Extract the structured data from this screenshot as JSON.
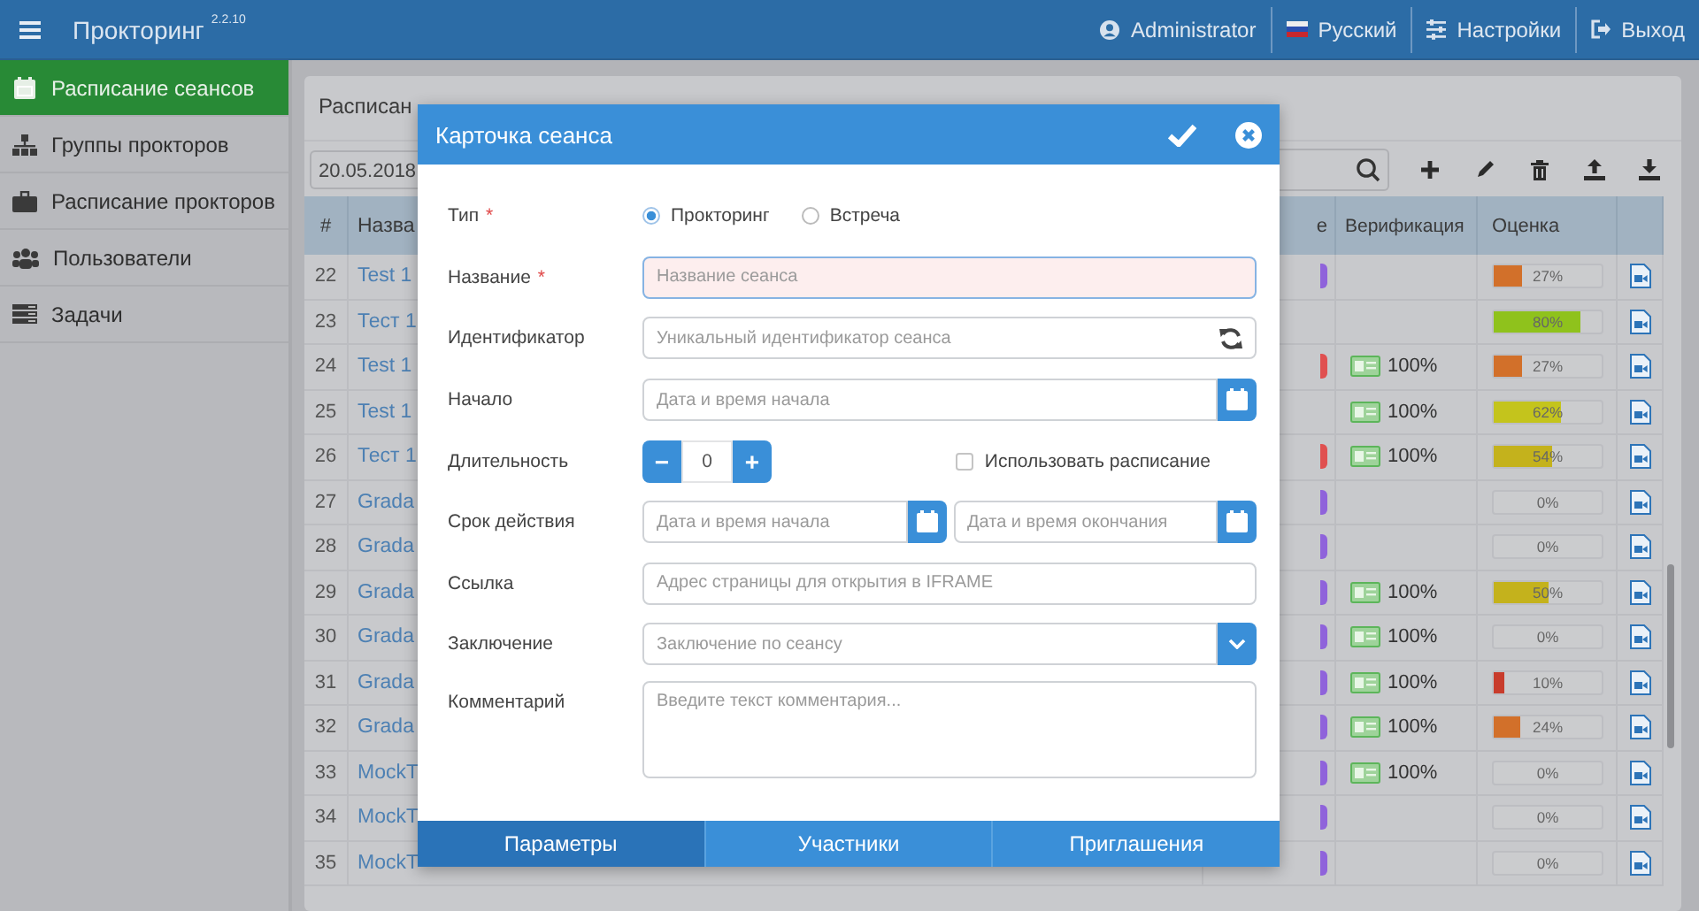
{
  "topbar": {
    "title": "Прокторинг",
    "version": "2.2.10",
    "menu": [
      {
        "kind": "user",
        "label": "Administrator"
      },
      {
        "kind": "language",
        "label": "Русский"
      },
      {
        "kind": "settings",
        "label": "Настройки"
      },
      {
        "kind": "logout",
        "label": "Выход"
      }
    ]
  },
  "sidebar": {
    "items": [
      {
        "kind": "calendar",
        "label": "Расписание сеансов",
        "selected": true
      },
      {
        "kind": "groups",
        "label": "Группы прокторов",
        "selected": false
      },
      {
        "kind": "briefcase",
        "label": "Расписание прокторов",
        "selected": false
      },
      {
        "kind": "users",
        "label": "Пользователи",
        "selected": false
      },
      {
        "kind": "tasks",
        "label": "Задачи",
        "selected": false
      }
    ]
  },
  "panel": {
    "title": "Расписан",
    "date_filter": "20.05.2018",
    "table": {
      "columns": [
        "#",
        "Назва",
        "е",
        "Верификация",
        "Оценка"
      ],
      "rows": [
        {
          "num": "22",
          "name": "Test 1",
          "color": "#8f63db",
          "score": {
            "level": 0.27,
            "text": "27%",
            "color": "#d2702a"
          }
        },
        {
          "num": "23",
          "name": "Тест 1",
          "score": {
            "level": 0.8,
            "text": "80%",
            "color": "#8fc21c"
          }
        },
        {
          "num": "24",
          "name": "Test 1",
          "color": "#e05050",
          "verification": "100%",
          "score": {
            "level": 0.27,
            "text": "27%",
            "color": "#d2702a"
          }
        },
        {
          "num": "25",
          "name": "Test 1",
          "verification": "100%",
          "score": {
            "level": 0.62,
            "text": "62%",
            "color": "#c4c41c"
          }
        },
        {
          "num": "26",
          "name": "Тест 1",
          "color": "#e05050",
          "verification": "100%",
          "score": {
            "level": 0.54,
            "text": "54%",
            "color": "#c4b21c"
          }
        },
        {
          "num": "27",
          "name": "Grada",
          "color": "#8f63db",
          "score": {
            "text": "0%"
          }
        },
        {
          "num": "28",
          "name": "Grada",
          "color": "#8f63db",
          "score": {
            "text": "0%"
          }
        },
        {
          "num": "29",
          "name": "Grada",
          "color": "#8f63db",
          "verification": "100%",
          "score": {
            "level": 0.5,
            "text": "50%",
            "color": "#c4b21c"
          }
        },
        {
          "num": "30",
          "name": "Grada",
          "color": "#8f63db",
          "verification": "100%",
          "score": {
            "text": "0%"
          }
        },
        {
          "num": "31",
          "name": "Grada",
          "color": "#8f63db",
          "verification": "100%",
          "score": {
            "level": 0.1,
            "text": "10%",
            "color": "#c83c2c"
          }
        },
        {
          "num": "32",
          "name": "Grada",
          "color": "#8f63db",
          "verification": "100%",
          "score": {
            "level": 0.24,
            "text": "24%",
            "color": "#d2702a"
          }
        },
        {
          "num": "33",
          "name": "MockT",
          "color": "#8f63db",
          "verification": "100%",
          "score": {
            "text": "0%"
          }
        },
        {
          "num": "34",
          "name": "MockT",
          "color": "#8f63db",
          "score": {
            "text": "0%"
          }
        },
        {
          "num": "35",
          "name": "MockT",
          "color": "#8f63db",
          "score": {
            "text": "0%"
          }
        }
      ]
    }
  },
  "dialog": {
    "title": "Карточка сеанса",
    "fields": [
      {
        "kind": "radio",
        "label": "Тип",
        "required_mark": "*",
        "options": [
          {
            "label": "Прокторинг",
            "selected": true
          },
          {
            "label": "Встреча",
            "selected": false
          }
        ]
      },
      {
        "kind": "text",
        "label": "Название",
        "required_mark": "*",
        "placeholder": "Название сеанса",
        "invalid": true
      },
      {
        "kind": "refresh",
        "label": "Идентификатор",
        "placeholder": "Уникальный идентификатор сеанса"
      },
      {
        "kind": "date",
        "label": "Начало",
        "placeholder": "Дата и время начала"
      },
      {
        "kind": "stepper",
        "label": "Длительность",
        "value": "0",
        "decrement": "−",
        "increment": "+",
        "checkbox": {
          "label": "Использовать расписание",
          "checked": false
        }
      },
      {
        "kind": "daterange",
        "label": "Срок действия",
        "placeholders": [
          "Дата и время начала",
          "Дата и время окончания"
        ]
      },
      {
        "kind": "text",
        "label": "Ссылка",
        "placeholder": "Адрес страницы для открытия в IFRAME",
        "invalid": false
      },
      {
        "kind": "select",
        "label": "Заключение",
        "placeholder": "Заключение по сеансу"
      },
      {
        "kind": "textarea",
        "label": "Комментарий",
        "placeholder": "Введите текст комментария..."
      }
    ],
    "tabs": [
      {
        "label": "Параметры",
        "selected": true
      },
      {
        "label": "Участники",
        "selected": false
      },
      {
        "label": "Приглашения",
        "selected": false
      }
    ]
  }
}
